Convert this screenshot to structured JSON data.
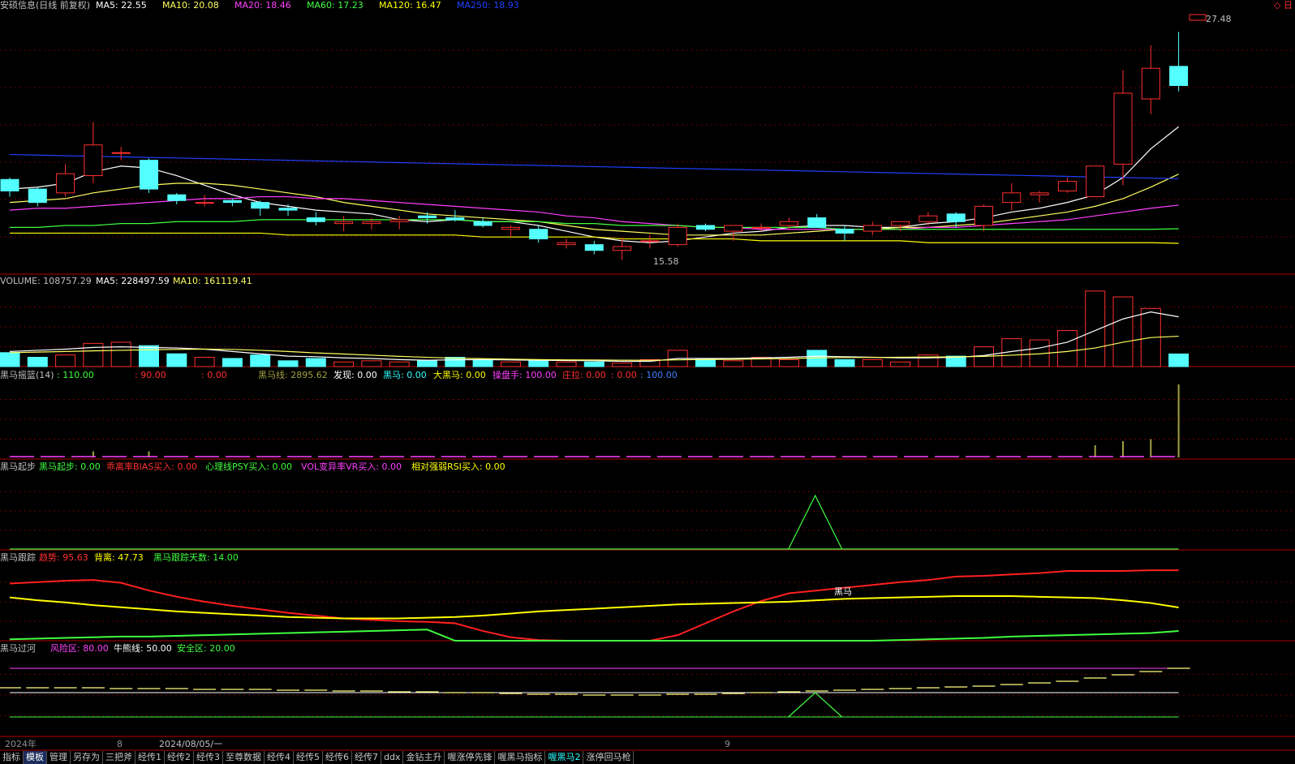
{
  "header": {
    "title": "安硕信息(日线 前复权)",
    "ma_items": [
      {
        "label": "MA5: 22.55",
        "color": "#ffffff"
      },
      {
        "label": "MA10: 20.08",
        "color": "#ffff60"
      },
      {
        "label": "MA20: 18.46",
        "color": "#ff40ff"
      },
      {
        "label": "MA60: 17.23",
        "color": "#40ff40"
      },
      {
        "label": "MA120: 16.47",
        "color": "#ffff00"
      },
      {
        "label": "MA250: 18.93",
        "color": "#2040ff"
      }
    ],
    "corner": "◇ 日"
  },
  "price_marks": {
    "high": "27.48",
    "low": "15.58"
  },
  "volume_header": [
    {
      "label": "VOLUME: 108757.29",
      "color": "#c0c0c0"
    },
    {
      "label": "MA5: 228497.59",
      "color": "#ffffff"
    },
    {
      "label": "MA10: 161119.41",
      "color": "#ffff60"
    }
  ],
  "panel3_header": [
    {
      "label": "黑马摇篮(14)",
      "color": "#c0c0c0"
    },
    {
      "label": ": 110.00",
      "color": "#40ff40"
    },
    {
      "label": ": 90.00",
      "color": "#ff3030"
    },
    {
      "label": ": 0.00",
      "color": "#ff3030"
    },
    {
      "label": "黑马线: 2895.62",
      "color": "#a0a040"
    },
    {
      "label": "发现: 0.00",
      "color": "#ffffff"
    },
    {
      "label": "黑马: 0.00",
      "color": "#30ffff"
    },
    {
      "label": "大黑马: 0.00",
      "color": "#ffff00"
    },
    {
      "label": "操盘手: 100.00",
      "color": "#ff40ff"
    },
    {
      "label": "庄拉: 0.00",
      "color": "#ff3030"
    },
    {
      "label": ": 0.00",
      "color": "#ff3030"
    },
    {
      "label": ": 100.00",
      "color": "#4080ff"
    }
  ],
  "panel4_header": [
    {
      "label": "黑马起步",
      "color": "#c0c0c0"
    },
    {
      "label": "黑马起步: 0.00",
      "color": "#40ff40"
    },
    {
      "label": "乖离率BIAS买入: 0.00",
      "color": "#ff3030"
    },
    {
      "label": "心理线PSY买入: 0.00",
      "color": "#40ff40"
    },
    {
      "label": "VOL变异率VR买入: 0.00",
      "color": "#ff40ff"
    },
    {
      "label": "相对强弱RSI买入: 0.00",
      "color": "#ffff00"
    }
  ],
  "panel5_header": [
    {
      "label": "黑马跟踪",
      "color": "#c0c0c0"
    },
    {
      "label": "趋势: 95.63",
      "color": "#ff3030"
    },
    {
      "label": "背离: 47.73",
      "color": "#ffff00"
    },
    {
      "label": "黑马跟踪天数: 14.00",
      "color": "#40ff40"
    }
  ],
  "panel5_annotation": "黑马",
  "panel6_header": [
    {
      "label": "黑马过河",
      "color": "#c0c0c0"
    },
    {
      "label": "风险区: 80.00",
      "color": "#ff40ff"
    },
    {
      "label": "牛熊线: 50.00",
      "color": "#ffffff"
    },
    {
      "label": "安全区: 20.00",
      "color": "#40ff40"
    }
  ],
  "time_axis": {
    "year": "2024年",
    "m1": "8",
    "date": "2024/08/05/一",
    "m2": "9"
  },
  "tabs": [
    {
      "label": "指标",
      "style": ""
    },
    {
      "label": "模板",
      "style": "active"
    },
    {
      "label": "管理",
      "style": ""
    },
    {
      "label": "另存为",
      "style": ""
    },
    {
      "label": "三把斧",
      "style": ""
    },
    {
      "label": "经传1",
      "style": ""
    },
    {
      "label": "经传2",
      "style": ""
    },
    {
      "label": "经传3",
      "style": ""
    },
    {
      "label": "至尊数据",
      "style": ""
    },
    {
      "label": "经传4",
      "style": ""
    },
    {
      "label": "经传5",
      "style": ""
    },
    {
      "label": "经传6",
      "style": ""
    },
    {
      "label": "经传7",
      "style": ""
    },
    {
      "label": "ddx",
      "style": ""
    },
    {
      "label": "金钻主升",
      "style": ""
    },
    {
      "label": "喔涨停先锋",
      "style": ""
    },
    {
      "label": "喔黑马指标",
      "style": ""
    },
    {
      "label": "喔黑马2",
      "style": "cy"
    },
    {
      "label": "涨停回马枪",
      "style": ""
    }
  ],
  "chart_data": {
    "type": "candlestick",
    "ohlc": [
      [
        19.8,
        19.9,
        18.9,
        19.2
      ],
      [
        19.3,
        19.4,
        18.4,
        18.6
      ],
      [
        19.1,
        20.6,
        18.9,
        20.1
      ],
      [
        20.0,
        22.8,
        19.6,
        21.6
      ],
      [
        21.2,
        21.5,
        20.8,
        21.2
      ],
      [
        20.8,
        20.9,
        19.1,
        19.3
      ],
      [
        19.0,
        19.1,
        18.5,
        18.7
      ],
      [
        18.6,
        19.0,
        18.4,
        18.6
      ],
      [
        18.7,
        18.8,
        18.4,
        18.6
      ],
      [
        18.6,
        18.7,
        17.9,
        18.3
      ],
      [
        18.3,
        18.5,
        17.9,
        18.2
      ],
      [
        17.8,
        18.1,
        17.4,
        17.6
      ],
      [
        17.5,
        17.9,
        17.1,
        17.6
      ],
      [
        17.5,
        17.8,
        17.2,
        17.6
      ],
      [
        17.6,
        17.9,
        17.2,
        17.7
      ],
      [
        17.9,
        18.1,
        17.5,
        17.8
      ],
      [
        17.8,
        18.2,
        17.6,
        17.7
      ],
      [
        17.6,
        17.8,
        17.3,
        17.4
      ],
      [
        17.2,
        17.4,
        16.8,
        17.3
      ],
      [
        17.2,
        17.4,
        16.5,
        16.7
      ],
      [
        16.4,
        16.7,
        16.2,
        16.5
      ],
      [
        16.4,
        16.6,
        15.9,
        16.1
      ],
      [
        16.1,
        16.8,
        15.6,
        16.3
      ],
      [
        16.6,
        16.9,
        16.2,
        16.6
      ],
      [
        16.4,
        17.5,
        16.3,
        17.3
      ],
      [
        17.4,
        17.5,
        17.1,
        17.2
      ],
      [
        17.1,
        17.3,
        16.6,
        17.4
      ],
      [
        17.3,
        17.5,
        17.1,
        17.3
      ],
      [
        17.4,
        17.8,
        17.2,
        17.6
      ],
      [
        17.8,
        18.0,
        17.3,
        17.3
      ],
      [
        17.2,
        17.4,
        16.6,
        17.0
      ],
      [
        17.1,
        17.6,
        16.9,
        17.4
      ],
      [
        17.4,
        17.6,
        17.1,
        17.6
      ],
      [
        17.6,
        18.1,
        17.4,
        17.9
      ],
      [
        18.0,
        18.1,
        17.3,
        17.6
      ],
      [
        17.4,
        18.5,
        17.1,
        18.4
      ],
      [
        18.6,
        19.6,
        18.2,
        19.1
      ],
      [
        19.0,
        19.2,
        18.6,
        19.1
      ],
      [
        19.2,
        19.9,
        19.1,
        19.7
      ],
      [
        18.9,
        20.5,
        19.0,
        20.5
      ],
      [
        20.6,
        25.5,
        19.5,
        24.3
      ],
      [
        24.0,
        26.8,
        23.2,
        25.6
      ],
      [
        25.7,
        27.5,
        24.4,
        24.7
      ]
    ],
    "ma": {
      "MA5": [
        19.3,
        19.4,
        19.6,
        20.2,
        20.5,
        20.4,
        20.0,
        19.5,
        19.0,
        18.6,
        18.4,
        18.2,
        18.1,
        18.0,
        17.7,
        17.6,
        17.7,
        17.6,
        17.6,
        17.4,
        17.1,
        16.8,
        16.6,
        16.5,
        16.6,
        16.8,
        17.0,
        17.1,
        17.3,
        17.4,
        17.4,
        17.3,
        17.3,
        17.5,
        17.6,
        17.8,
        18.1,
        18.3,
        18.6,
        19.0,
        19.9,
        21.4,
        22.55
      ],
      "MA10": [
        18.6,
        18.7,
        18.8,
        19.1,
        19.3,
        19.5,
        19.6,
        19.6,
        19.5,
        19.3,
        19.1,
        18.9,
        18.6,
        18.4,
        18.2,
        18.0,
        17.9,
        17.8,
        17.7,
        17.6,
        17.4,
        17.2,
        17.1,
        17.0,
        16.9,
        16.9,
        16.9,
        16.9,
        17.0,
        17.1,
        17.2,
        17.2,
        17.3,
        17.3,
        17.4,
        17.5,
        17.7,
        17.9,
        18.1,
        18.4,
        18.8,
        19.4,
        20.08
      ],
      "MA20": [
        18.2,
        18.3,
        18.3,
        18.4,
        18.5,
        18.6,
        18.7,
        18.8,
        18.8,
        18.9,
        18.9,
        18.8,
        18.8,
        18.7,
        18.6,
        18.5,
        18.4,
        18.3,
        18.2,
        18.1,
        17.9,
        17.8,
        17.6,
        17.5,
        17.4,
        17.3,
        17.3,
        17.2,
        17.2,
        17.2,
        17.2,
        17.2,
        17.2,
        17.3,
        17.3,
        17.4,
        17.5,
        17.6,
        17.7,
        17.9,
        18.1,
        18.3,
        18.46
      ],
      "MA60": [
        17.3,
        17.3,
        17.4,
        17.4,
        17.5,
        17.5,
        17.6,
        17.6,
        17.6,
        17.7,
        17.7,
        17.7,
        17.7,
        17.7,
        17.7,
        17.7,
        17.7,
        17.6,
        17.6,
        17.6,
        17.5,
        17.5,
        17.4,
        17.4,
        17.4,
        17.3,
        17.3,
        17.3,
        17.3,
        17.3,
        17.2,
        17.2,
        17.2,
        17.2,
        17.2,
        17.2,
        17.2,
        17.2,
        17.2,
        17.2,
        17.2,
        17.2,
        17.23
      ],
      "MA120": [
        17.0,
        17.0,
        17.0,
        17.0,
        17.0,
        17.0,
        17.0,
        17.0,
        17.0,
        17.0,
        16.9,
        16.9,
        16.9,
        16.9,
        16.9,
        16.9,
        16.9,
        16.8,
        16.8,
        16.8,
        16.8,
        16.8,
        16.7,
        16.7,
        16.7,
        16.7,
        16.7,
        16.6,
        16.6,
        16.6,
        16.6,
        16.6,
        16.6,
        16.5,
        16.5,
        16.5,
        16.5,
        16.5,
        16.5,
        16.5,
        16.5,
        16.5,
        16.47
      ],
      "MA250": [
        21.1,
        21.07,
        21.04,
        21.01,
        20.98,
        20.95,
        20.92,
        20.89,
        20.86,
        20.83,
        20.8,
        20.77,
        20.74,
        20.71,
        20.68,
        20.65,
        20.62,
        20.59,
        20.56,
        20.53,
        20.5,
        20.47,
        20.44,
        20.41,
        20.38,
        20.35,
        20.32,
        20.29,
        20.26,
        20.23,
        20.2,
        20.17,
        20.14,
        20.11,
        20.08,
        20.05,
        20.02,
        19.99,
        19.96,
        19.93,
        19.9,
        19.87,
        19.84
      ]
    },
    "volume": [
      120000,
      80000,
      100000,
      200000,
      210000,
      180000,
      110000,
      80000,
      70000,
      100000,
      50000,
      70000,
      40000,
      50000,
      40000,
      50000,
      80000,
      60000,
      40000,
      50000,
      40000,
      40000,
      30000,
      60000,
      140000,
      70000,
      50000,
      80000,
      60000,
      140000,
      60000,
      60000,
      40000,
      100000,
      90000,
      170000,
      240000,
      230000,
      310000,
      650000,
      600000,
      500000,
      108757.29
    ],
    "volume_ma": {
      "MA5": [
        130000,
        140000,
        150000,
        165000,
        170000,
        165000,
        160000,
        150000,
        130000,
        110000,
        90000,
        85000,
        75000,
        70000,
        60000,
        55000,
        58000,
        60000,
        57000,
        55000,
        52000,
        50000,
        45000,
        45000,
        70000,
        70000,
        70000,
        75000,
        80000,
        90000,
        85000,
        80000,
        75000,
        75000,
        80000,
        95000,
        130000,
        160000,
        210000,
        310000,
        410000,
        470000,
        428497.59
      ],
      "MA10": [
        120000,
        125000,
        130000,
        135000,
        140000,
        145000,
        148000,
        150000,
        148000,
        140000,
        130000,
        118000,
        108000,
        98000,
        88000,
        80000,
        73000,
        68000,
        64000,
        60000,
        58000,
        57000,
        55000,
        54000,
        58000,
        61000,
        63000,
        66000,
        69000,
        75000,
        78000,
        79000,
        80000,
        82000,
        84000,
        88000,
        98000,
        110000,
        130000,
        160000,
        210000,
        250000,
        261119.41
      ]
    },
    "hm_cradle": [
      0,
      0,
      0,
      3,
      0,
      3,
      0,
      0,
      0,
      0,
      0,
      0,
      0,
      0,
      0,
      0,
      0,
      0,
      0,
      0,
      0,
      0,
      0,
      0,
      0,
      0,
      0,
      0,
      0,
      0,
      0,
      0,
      0,
      0,
      0,
      0,
      0,
      0,
      0,
      6,
      8,
      9,
      36
    ],
    "hm_start_peak_index": 29,
    "tracking": {
      "trend": [
        82,
        84,
        86,
        87,
        83,
        72,
        63,
        56,
        50,
        45,
        40,
        36,
        32,
        30,
        28,
        27,
        25,
        14,
        5,
        1,
        0,
        0,
        0,
        0,
        8,
        25,
        42,
        57,
        68,
        72,
        76,
        80,
        84,
        87,
        92,
        93,
        95,
        97,
        100,
        100,
        100,
        101,
        101
      ],
      "divergence": [
        62,
        58,
        55,
        51,
        48,
        45,
        42,
        40,
        38,
        36,
        34,
        33,
        32,
        32,
        32,
        33,
        34,
        36,
        39,
        42,
        44,
        46,
        48,
        50,
        52,
        53,
        54,
        55,
        56,
        58,
        60,
        61,
        62,
        63,
        64,
        64,
        64,
        63,
        62,
        61,
        58,
        54,
        47.73
      ],
      "days": [
        2,
        3,
        4,
        5,
        6,
        6,
        7,
        8,
        9,
        10,
        11,
        12,
        13,
        14,
        15,
        16,
        0,
        0,
        0,
        0,
        0,
        0,
        0,
        0,
        0,
        0,
        0,
        0,
        0,
        0,
        0,
        0,
        1,
        2,
        3,
        4,
        6,
        7,
        8,
        9,
        10,
        11,
        14
      ]
    },
    "crossing": {
      "risk": 80,
      "bull_bear": 50,
      "safe": 20
    },
    "crossing_series": [
      56,
      56,
      56,
      56,
      55,
      55,
      55,
      54,
      54,
      54,
      53,
      53,
      52,
      52,
      51,
      51,
      50,
      50,
      49,
      48,
      48,
      47,
      47,
      47,
      48,
      48,
      49,
      50,
      51,
      52,
      53,
      54,
      55,
      56,
      57,
      58,
      60,
      62,
      64,
      68,
      72,
      76,
      80
    ]
  }
}
